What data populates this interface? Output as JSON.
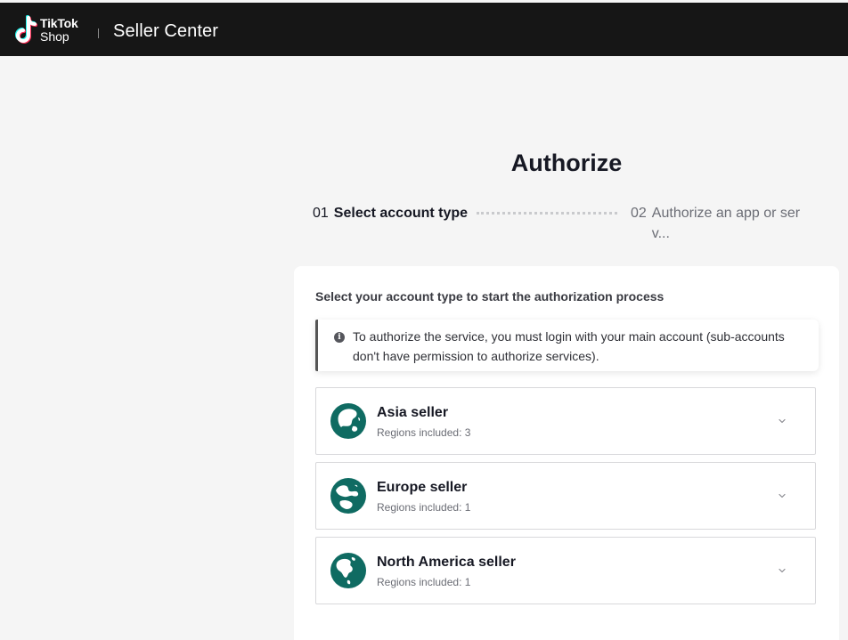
{
  "header": {
    "logo_line1": "TikTok",
    "logo_line2": "Shop",
    "app_name": "Seller Center"
  },
  "page": {
    "title": "Authorize"
  },
  "steps": [
    {
      "number": "01",
      "label": "Select account type",
      "active": true
    },
    {
      "number": "02",
      "label": "Authorize an app or serv...",
      "active": false
    }
  ],
  "card": {
    "subtitle": "Select your account type to start the authorization process",
    "notice": "To authorize the service, you must login with your main account (sub-accounts don't have permission to authorize services).",
    "regions": [
      {
        "name": "Asia seller",
        "sub": "Regions included: 3",
        "icon": "asia-globe-icon"
      },
      {
        "name": "Europe seller",
        "sub": "Regions included: 1",
        "icon": "europe-globe-icon"
      },
      {
        "name": "North America seller",
        "sub": "Regions included: 1",
        "icon": "north-america-globe-icon"
      }
    ]
  },
  "colors": {
    "header_bg": "#161616",
    "page_bg": "#f5f5f5",
    "globe_teal": "#0f6b62",
    "brand_cyan": "#25f4ee",
    "brand_red": "#fe2c55"
  }
}
